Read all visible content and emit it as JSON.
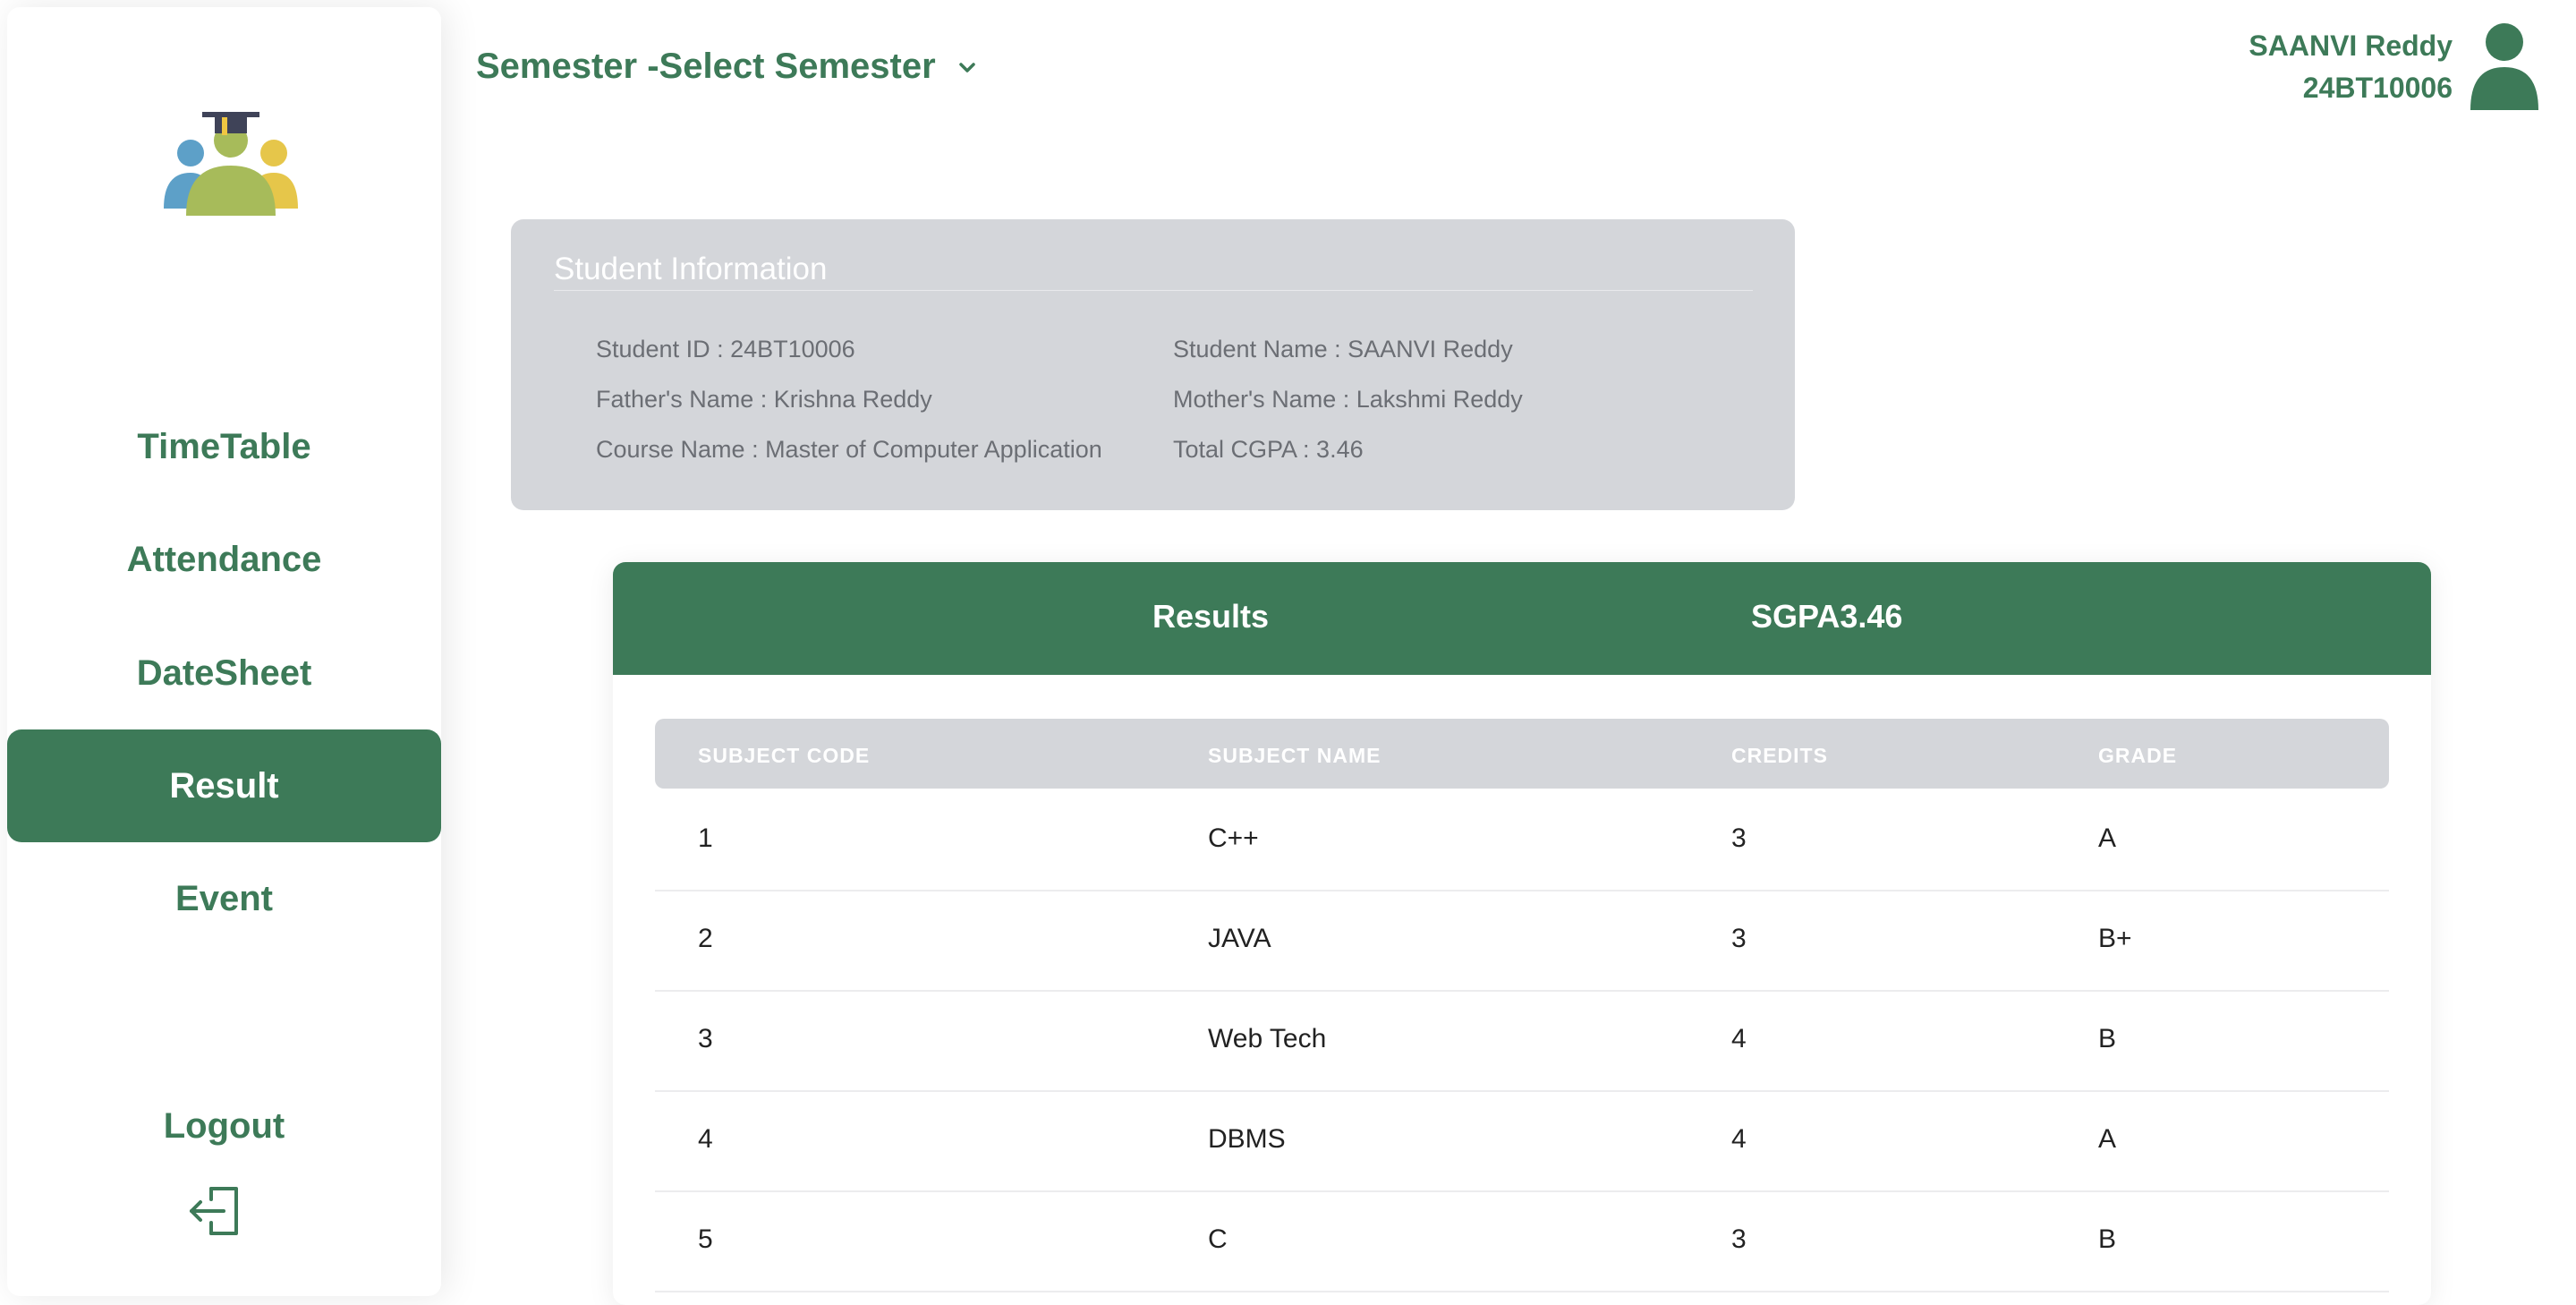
{
  "sidebar": {
    "items": [
      {
        "label": "TimeTable"
      },
      {
        "label": "Attendance"
      },
      {
        "label": "DateSheet"
      },
      {
        "label": "Result"
      },
      {
        "label": "Event"
      }
    ],
    "active_item": "Result",
    "logout_label": "Logout"
  },
  "header": {
    "semester_label": "Semester -Select Semester",
    "user_name": "SAANVI Reddy",
    "user_id": "24BT10006"
  },
  "student_info": {
    "title": "Student Information",
    "student_id": "Student ID : 24BT10006",
    "student_name": "Student Name : SAANVI Reddy",
    "father_name": "Father's Name : Krishna Reddy",
    "mother_name": "Mother's Name : Lakshmi Reddy",
    "course_name": "Course Name : Master of Computer Application",
    "total_cgpa": "Total CGPA : 3.46"
  },
  "results": {
    "title": "Results",
    "sgpa": "SGPA3.46",
    "columns": [
      "SUBJECT CODE",
      "SUBJECT NAME",
      "CREDITS",
      "GRADE"
    ],
    "rows": [
      {
        "code": "1",
        "name": "C++",
        "credits": "3",
        "grade": "A"
      },
      {
        "code": "2",
        "name": "JAVA",
        "credits": "3",
        "grade": "B+"
      },
      {
        "code": "3",
        "name": "Web Tech",
        "credits": "4",
        "grade": "B"
      },
      {
        "code": "4",
        "name": "DBMS",
        "credits": "4",
        "grade": "A"
      },
      {
        "code": "5",
        "name": "C",
        "credits": "3",
        "grade": "B"
      }
    ]
  },
  "colors": {
    "primary": "#3d7a58",
    "panel_gray": "#d4d6da",
    "white": "#ffffff"
  },
  "icons": {
    "logo": "student-group-graduation-logo",
    "semester_toggle": "chevron-down-icon",
    "avatar": "user-avatar-icon",
    "logout": "logout-icon"
  }
}
